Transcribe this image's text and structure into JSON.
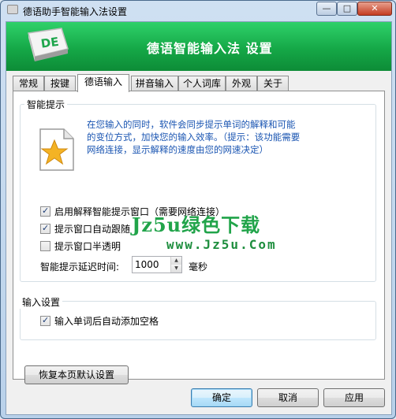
{
  "window": {
    "title": "德语助手智能输入法设置",
    "controls": {
      "minimize": "—",
      "maximize": "□",
      "close": "✕"
    }
  },
  "banner": {
    "logo_text": "DE",
    "title": "德语智能输入法 设置"
  },
  "tabs": [
    {
      "label": "常规"
    },
    {
      "label": "按键"
    },
    {
      "label": "德语输入",
      "active": true
    },
    {
      "label": "拼音输入"
    },
    {
      "label": "个人词库"
    },
    {
      "label": "外观"
    },
    {
      "label": "关于"
    }
  ],
  "smart_hint": {
    "group_label": "智能提示",
    "description": "在您输入的同时，软件会同步提示单词的解释和可能的变位方式，加快您的输入效率。（提示：该功能需要网络连接，显示解释的速度由您的网速决定）",
    "options": [
      {
        "label": "启用解释智能提示窗口（需要网络连接）",
        "checked": true
      },
      {
        "label": "提示窗口自动跟随",
        "checked": true
      },
      {
        "label": "提示窗口半透明",
        "checked": false
      }
    ],
    "delay_label": "智能提示延迟时间:",
    "delay_value": "1000",
    "delay_unit": "毫秒"
  },
  "input_settings": {
    "group_label": "输入设置",
    "options": [
      {
        "label": "输入单词后自动添加空格",
        "checked": true
      }
    ]
  },
  "watermark": {
    "line1": "Jz5u绿色下载",
    "line2": "www.Jz5u.Com"
  },
  "buttons": {
    "restore_defaults": "恢复本页默认设置",
    "ok": "确定",
    "cancel": "取消",
    "apply": "应用"
  },
  "colors": {
    "banner_green": "#15a847",
    "description_blue": "#1a55b2",
    "watermark_green": "#21a44a"
  }
}
